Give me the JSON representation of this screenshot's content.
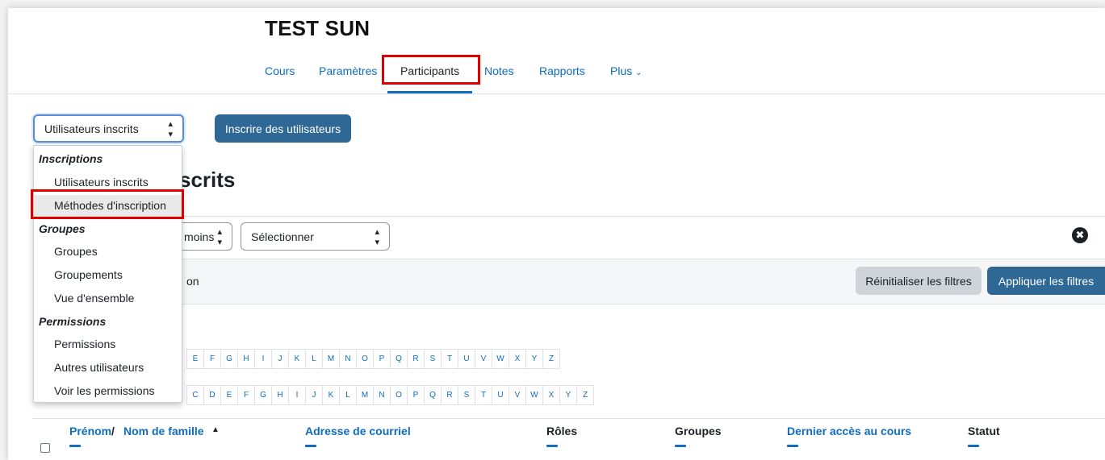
{
  "course": {
    "title": "TEST SUN"
  },
  "nav": {
    "items": [
      {
        "label": "Cours"
      },
      {
        "label": "Paramètres"
      },
      {
        "label": "Participants"
      },
      {
        "label": "Notes"
      },
      {
        "label": "Rapports"
      },
      {
        "label": "Plus",
        "icon": "chevron-down-icon"
      }
    ],
    "active": "Participants"
  },
  "enrol_select": {
    "value": "Utilisateurs inscrits"
  },
  "enrol_button": {
    "label": "Inscrire des utilisateurs"
  },
  "page_heading": {
    "visible_text": "scrits"
  },
  "filters": {
    "match_select_visible": "moins",
    "type_select": "Sélectionner",
    "row2_text_visible": "on",
    "reset_label": "Réinitialiser les filtres",
    "apply_label": "Appliquer les filtres",
    "remove_icon": "close-circle-icon"
  },
  "initials": {
    "firstname_visible": [
      "E",
      "F",
      "G",
      "H",
      "I",
      "J",
      "K",
      "L",
      "M",
      "N",
      "O",
      "P",
      "Q",
      "R",
      "S",
      "T",
      "U",
      "V",
      "W",
      "X",
      "Y",
      "Z"
    ],
    "lastname_visible": [
      "C",
      "D",
      "E",
      "F",
      "G",
      "H",
      "I",
      "J",
      "K",
      "L",
      "M",
      "N",
      "O",
      "P",
      "Q",
      "R",
      "S",
      "T",
      "U",
      "V",
      "W",
      "X",
      "Y",
      "Z"
    ]
  },
  "table": {
    "headers": {
      "firstname": "Prénom",
      "separator": " / ",
      "lastname": "Nom de famille",
      "sort_icon": "▲",
      "email": "Adresse de courriel",
      "roles": "Rôles",
      "groups": "Groupes",
      "lastaccess": "Dernier accès au cours",
      "status": "Statut"
    }
  },
  "dropdown": {
    "groups": [
      {
        "label": "Inscriptions",
        "items": [
          "Utilisateurs inscrits",
          "Méthodes d'inscription"
        ]
      },
      {
        "label": "Groupes",
        "items": [
          "Groupes",
          "Groupements",
          "Vue d'ensemble"
        ]
      },
      {
        "label": "Permissions",
        "items": [
          "Permissions",
          "Autres utilisateurs",
          "Voir les permissions"
        ]
      }
    ],
    "highlighted": "Méthodes d'inscription"
  },
  "colors": {
    "link": "#0f6cbf",
    "primary_button": "#2f6795",
    "secondary_button": "#ced4da",
    "highlight_box": "#e00000"
  }
}
